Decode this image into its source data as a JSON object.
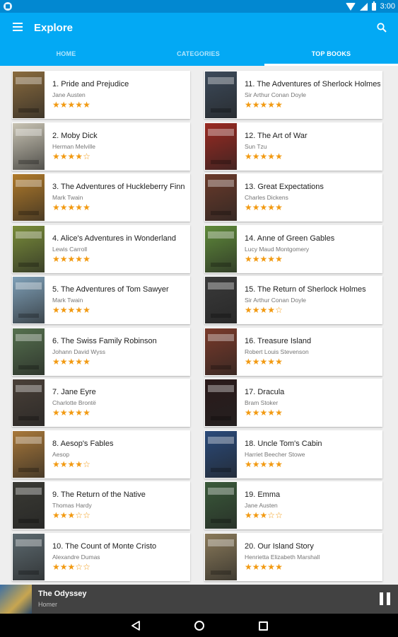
{
  "status_bar": {
    "time": "3:00"
  },
  "app_bar": {
    "title": "Explore"
  },
  "tabs": [
    {
      "label": "HOME"
    },
    {
      "label": "CATEGORIES"
    },
    {
      "label": "TOP BOOKS"
    }
  ],
  "active_tab": "TOP BOOKS",
  "books": [
    {
      "title": "1. Pride and Prejudice",
      "author": "Jane Austen",
      "rating": 5,
      "cover_color": "#8a6b3e"
    },
    {
      "title": "2. Moby Dick",
      "author": "Herman Melville",
      "rating": 4,
      "cover_color": "#c9c4b4"
    },
    {
      "title": "3. The Adventures of Huckleberry Finn",
      "author": "Mark Twain",
      "rating": 5,
      "cover_color": "#b07a2a"
    },
    {
      "title": "4. Alice's Adventures in Wonderland",
      "author": "Lewis Carroll",
      "rating": 5,
      "cover_color": "#7a8d3a"
    },
    {
      "title": "5. The Adventures of Tom Sawyer",
      "author": "Mark Twain",
      "rating": 5,
      "cover_color": "#7fa0b8"
    },
    {
      "title": "6. The Swiss Family Robinson",
      "author": "Johann David Wyss",
      "rating": 5,
      "cover_color": "#55704e"
    },
    {
      "title": "7. Jane Eyre",
      "author": "Charlotte Brontë",
      "rating": 5,
      "cover_color": "#4a4038"
    },
    {
      "title": "8. Aesop's Fables",
      "author": "Aesop",
      "rating": 4,
      "cover_color": "#a8783a"
    },
    {
      "title": "9. The Return of the Native",
      "author": "Thomas Hardy",
      "rating": 3,
      "cover_color": "#3a3a34"
    },
    {
      "title": "10. The Count of Monte Cristo",
      "author": "Alexandre Dumas",
      "rating": 3,
      "cover_color": "#5d6a70"
    },
    {
      "title": "11. The Adventures of Sherlock Holmes",
      "author": "Sir Arthur Conan Doyle",
      "rating": 5,
      "cover_color": "#3c4a5a"
    },
    {
      "title": "12. The Art of War",
      "author": "Sun Tzu",
      "rating": 5,
      "cover_color": "#9a2a22"
    },
    {
      "title": "13. Great Expectations",
      "author": "Charles Dickens",
      "rating": 5,
      "cover_color": "#6a3a2a"
    },
    {
      "title": "14. Anne of Green Gables",
      "author": "Lucy Maud Montgomery",
      "rating": 5,
      "cover_color": "#5f8a3a"
    },
    {
      "title": "15. The Return of Sherlock Holmes",
      "author": "Sir Arthur Conan Doyle",
      "rating": 4,
      "cover_color": "#3a3a3a"
    },
    {
      "title": "16. Treasure Island",
      "author": "Robert Louis Stevenson",
      "rating": 5,
      "cover_color": "#7a3a2a"
    },
    {
      "title": "17. Dracula",
      "author": "Bram Stoker",
      "rating": 5,
      "cover_color": "#2a1a1a"
    },
    {
      "title": "18. Uncle Tom's Cabin",
      "author": "Harriet Beecher Stowe",
      "rating": 5,
      "cover_color": "#2a4a7a"
    },
    {
      "title": "19. Emma",
      "author": "Jane Austen",
      "rating": 3,
      "cover_color": "#3a5a3a"
    },
    {
      "title": "20. Our Island Story",
      "author": "Henrietta Elizabeth Marshall",
      "rating": 5,
      "cover_color": "#8a7a5a"
    }
  ],
  "player": {
    "title": "The Odyssey",
    "author": "Homer"
  },
  "icons": {
    "menu": "menu-icon",
    "search": "search-icon",
    "pause": "pause-icon",
    "back": "back-icon",
    "home": "home-icon",
    "recents": "recents-icon"
  },
  "colors": {
    "primary": "#03a9f4",
    "status_bar": "#0288d1",
    "star": "#f29a12",
    "player_bg": "#424242"
  }
}
